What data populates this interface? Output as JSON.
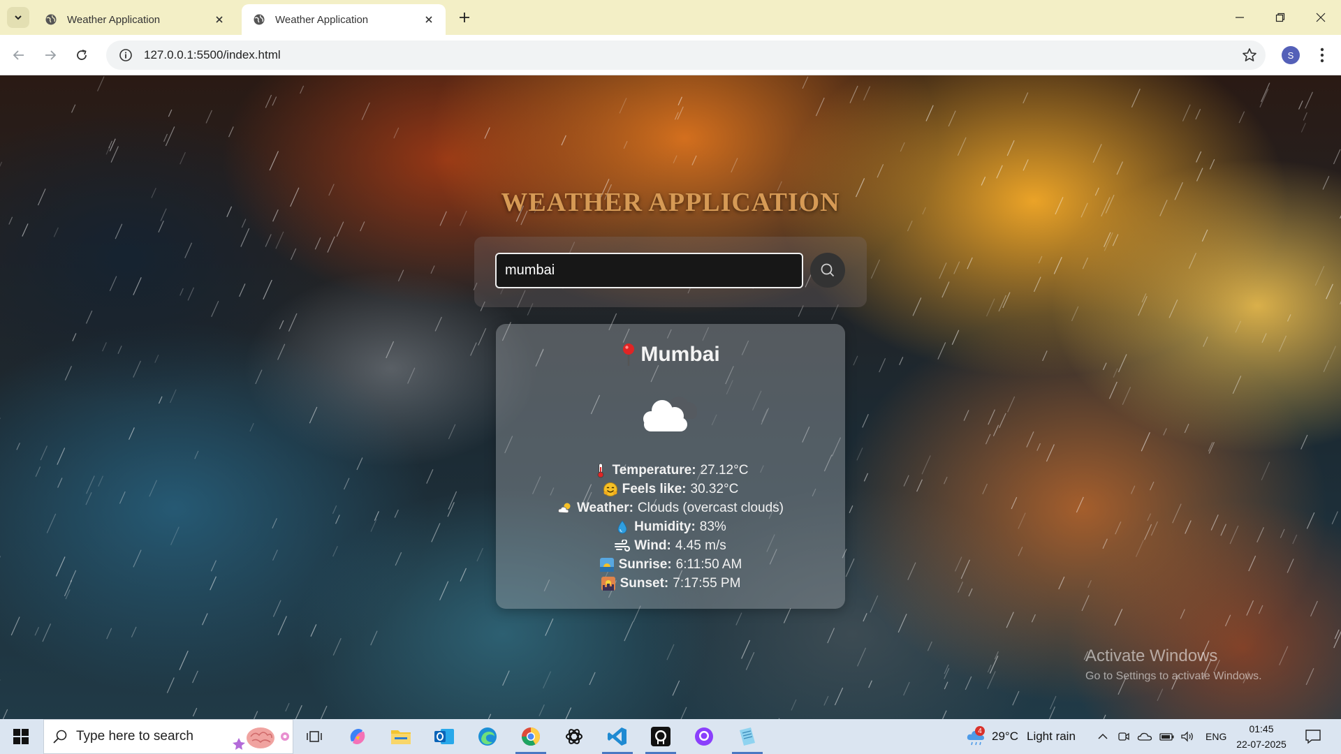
{
  "browser": {
    "tabs": [
      {
        "title": "Weather Application",
        "active": false
      },
      {
        "title": "Weather Application",
        "active": true
      }
    ],
    "url": "127.0.0.1:5500/index.html",
    "profile_initial": "S"
  },
  "app": {
    "title": "WEATHER APPLICATION",
    "search": {
      "value": "mumbai"
    },
    "card": {
      "city": "Mumbai",
      "condition_icon": "cloud-icon",
      "details": [
        {
          "icon": "thermometer-icon",
          "label": "Temperature:",
          "value": "27.12°C"
        },
        {
          "icon": "hugging-face-icon",
          "label": "Feels like:",
          "value": "30.32°C"
        },
        {
          "icon": "sun-behind-cloud-icon",
          "label": "Weather:",
          "value": "Clouds (overcast clouds)"
        },
        {
          "icon": "droplet-icon",
          "label": "Humidity:",
          "value": "83%"
        },
        {
          "icon": "wind-icon",
          "label": "Wind:",
          "value": "4.45 m/s"
        },
        {
          "icon": "sunrise-icon",
          "label": "Sunrise:",
          "value": "6:11:50 AM"
        },
        {
          "icon": "sunset-icon",
          "label": "Sunset:",
          "value": "7:17:55 PM"
        }
      ]
    }
  },
  "watermark": {
    "line1": "Activate Windows",
    "line2": "Go to Settings to activate Windows."
  },
  "taskbar": {
    "search_placeholder": "Type here to search",
    "weather": {
      "badge": "4",
      "temp": "29°C",
      "condition": "Light rain"
    },
    "language": "ENG",
    "time": "01:45",
    "date": "22-07-2025"
  },
  "colors": {
    "title": "#d69a55",
    "tabbar": "#f3efc6",
    "taskbar": "#dbe5f1",
    "profile": "#5460b8"
  }
}
